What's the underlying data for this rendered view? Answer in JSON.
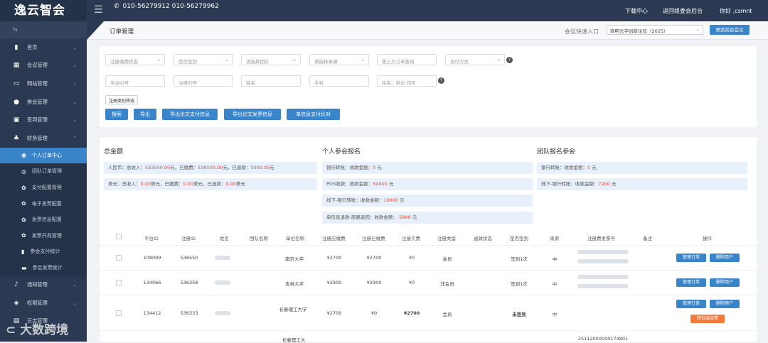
{
  "app": {
    "logo": "逸云智会",
    "phone": "010-56279912 010-56279962",
    "download": "下载中心",
    "back": "返回组委会后台",
    "greeting": "你好 ,csmnt"
  },
  "sidebar": {
    "top": "⇆",
    "items": [
      {
        "label": "首页",
        "icon": "home"
      },
      {
        "label": "会议管理",
        "icon": "grid"
      },
      {
        "label": "网站管理",
        "icon": "monitor"
      },
      {
        "label": "参会管理",
        "icon": "users"
      },
      {
        "label": "签到管理",
        "icon": "calendar"
      },
      {
        "label": "财务管理",
        "icon": "money"
      }
    ],
    "subitems": [
      "个人订单中心",
      "团队订单管理",
      "支付配置管理",
      "电子发票配置",
      "发票信息配置",
      "发票开具管理",
      "参会支付统计",
      "参会发票统计"
    ],
    "bottom": [
      {
        "label": "通知管理"
      },
      {
        "label": "权限管理"
      }
    ],
    "bottom3": "日志管理"
  },
  "page": {
    "title": "订单管理",
    "quick_label": "会议快速入口",
    "quick_value": "商明光学创新论坛（2025）",
    "quick_btn": "预览前台会议"
  },
  "filters": {
    "row1": [
      "注册缴费状态",
      "是否签到",
      "请选择团队",
      "请选择来源",
      "第三方订单查询",
      "支付方式"
    ],
    "row2": [
      "平台ID号",
      "注册ID号",
      "姓名",
      "手机",
      "姓名、单位 均可"
    ],
    "tag": "注册类别筛选"
  },
  "actions": [
    "搜索",
    "导出",
    "导出论文支付信息",
    "导出论文发票信息",
    "单信息支付比对"
  ],
  "summary": {
    "total_title": "总金额",
    "personal_title": "个人参会报名",
    "team_title": "团队报名参会",
    "rmb_label": "人民币：总收入：",
    "rmb_total": "533500.00",
    "rmb_mid": "元，已缴费：",
    "rmb_paid": "538500.00",
    "rmb_mid2": "元，已退款：",
    "rmb_refund": "5000.00",
    "rmb_end": "元",
    "usd_label": "美元：总收入：",
    "usd_total": "0.00",
    "usd_mid": "美元，已缴费：",
    "usd_paid": "0.00",
    "usd_mid2": "美元，已退款：",
    "usd_refund": "0.00",
    "usd_end": "美元",
    "p_bank": "银行转账：收款金额：",
    "p_bank_val": "0",
    "p_pos": "POS收款：收款金额：",
    "p_pos_val": "54000",
    "p_offline": "线下-银行转账：收款金额：",
    "p_offline_val": "10000",
    "p_refund": "单信息退款-原路返回：收款金额：",
    "p_refund_val": "-5000",
    "t_bank": "银行转账：收款金额：",
    "t_bank_val": "0",
    "t_offline": "线下-银行转账：收款金额：",
    "t_offline_val": "7200",
    "unit": "元"
  },
  "table": {
    "headers": [
      "平台ID",
      "注册ID",
      "姓名",
      "团队名称",
      "单位名称",
      "注册应缴费",
      "注册已缴费",
      "注册欠费",
      "注册类型",
      "退款状态",
      "是否签到",
      "来源",
      "注册费发票号",
      "备注",
      "操作"
    ],
    "rows": [
      {
        "pid": "108099",
        "rid": "536550",
        "unit": "南京大学",
        "due": "¥2700",
        "paid": "¥2700",
        "owe": "¥0",
        "type": "会员",
        "sign": "签到1次",
        "src": "中"
      },
      {
        "pid": "134066",
        "rid": "536358",
        "unit": "吉林大学",
        "due": "¥2900",
        "paid": "¥2900",
        "owe": "¥0",
        "type": "非会员",
        "sign": "签到1次",
        "src": "中"
      },
      {
        "pid": "134412",
        "rid": "536333",
        "unit": "长春理工大学",
        "due": "¥2700",
        "paid": "¥0",
        "owe": "¥2700",
        "type": "会员",
        "sign": "未签到",
        "src": "中"
      },
      {
        "unit": "长春理工大",
        "invoice": "25112000000174801"
      }
    ],
    "btn_manage": "管理订单",
    "btn_delete": "删除用户",
    "btn_orange": "降低层级费"
  },
  "watermark": "⊂ 大数跨境"
}
